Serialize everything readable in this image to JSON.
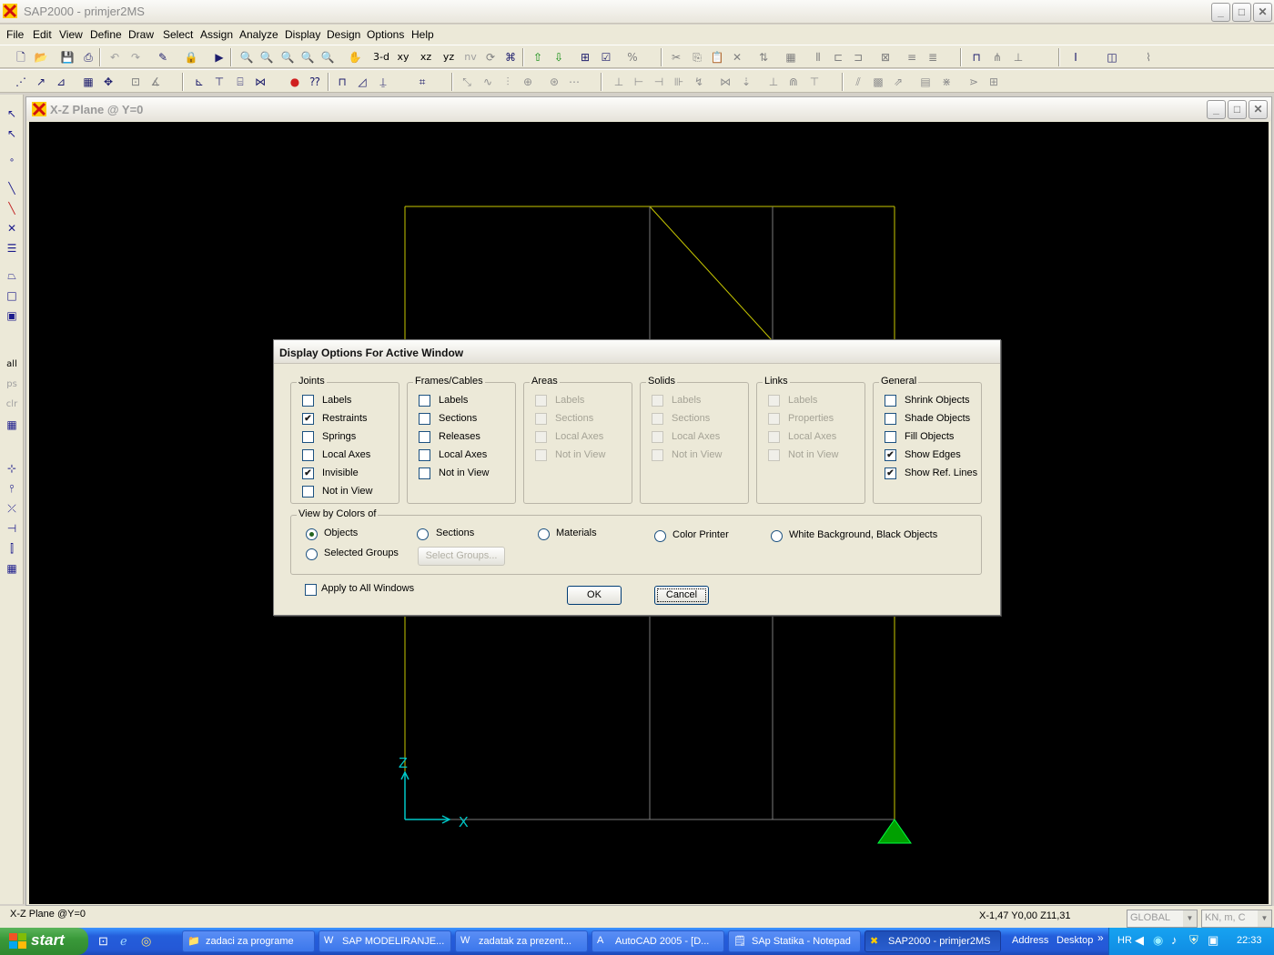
{
  "app": {
    "title": "SAP2000 - primjer2MS",
    "window_buttons": {
      "minimize": "_",
      "maximize": "□",
      "close": "✕"
    }
  },
  "menu": [
    "File",
    "Edit",
    "View",
    "Define",
    "Draw",
    "Select",
    "Assign",
    "Analyze",
    "Display",
    "Design",
    "Options",
    "Help"
  ],
  "toolbar1": {
    "view_buttons": [
      "3-d",
      "xy",
      "xz",
      "yz",
      "nv"
    ]
  },
  "child_window": {
    "title": "X-Z Plane @ Y=0",
    "canvas_bg": "#000000",
    "frame_color": "#c8c800",
    "axis_color": "#00c8c8",
    "restraint_color": "#00a000",
    "axes": {
      "x_label": "X",
      "z_label": "Z"
    }
  },
  "dialog": {
    "title": "Display Options For Active Window",
    "groups": [
      {
        "label": "Joints",
        "items": [
          {
            "label": "Labels",
            "checked": false,
            "enabled": true
          },
          {
            "label": "Restraints",
            "checked": true,
            "enabled": true
          },
          {
            "label": "Springs",
            "checked": false,
            "enabled": true
          },
          {
            "label": "Local Axes",
            "checked": false,
            "enabled": true
          },
          {
            "label": "Invisible",
            "checked": true,
            "enabled": true
          },
          {
            "label": "Not in View",
            "checked": false,
            "enabled": true
          }
        ]
      },
      {
        "label": "Frames/Cables",
        "items": [
          {
            "label": "Labels",
            "checked": false,
            "enabled": true
          },
          {
            "label": "Sections",
            "checked": false,
            "enabled": true
          },
          {
            "label": "Releases",
            "checked": false,
            "enabled": true
          },
          {
            "label": "Local Axes",
            "checked": false,
            "enabled": true
          },
          {
            "label": "Not in View",
            "checked": false,
            "enabled": true
          }
        ]
      },
      {
        "label": "Areas",
        "items": [
          {
            "label": "Labels",
            "checked": false,
            "enabled": false
          },
          {
            "label": "Sections",
            "checked": false,
            "enabled": false
          },
          {
            "label": "Local Axes",
            "checked": false,
            "enabled": false
          },
          {
            "label": "Not in View",
            "checked": false,
            "enabled": false
          }
        ]
      },
      {
        "label": "Solids",
        "items": [
          {
            "label": "Labels",
            "checked": false,
            "enabled": false
          },
          {
            "label": "Sections",
            "checked": false,
            "enabled": false
          },
          {
            "label": "Local Axes",
            "checked": false,
            "enabled": false
          },
          {
            "label": "Not in View",
            "checked": false,
            "enabled": false
          }
        ]
      },
      {
        "label": "Links",
        "items": [
          {
            "label": "Labels",
            "checked": false,
            "enabled": false
          },
          {
            "label": "Properties",
            "checked": false,
            "enabled": false
          },
          {
            "label": "Local Axes",
            "checked": false,
            "enabled": false
          },
          {
            "label": "Not in View",
            "checked": false,
            "enabled": false
          }
        ]
      },
      {
        "label": "General",
        "items": [
          {
            "label": "Shrink Objects",
            "checked": false,
            "enabled": true
          },
          {
            "label": "Shade Objects",
            "checked": false,
            "enabled": true
          },
          {
            "label": "Fill Objects",
            "checked": false,
            "enabled": true
          },
          {
            "label": "Show Edges",
            "checked": true,
            "enabled": true
          },
          {
            "label": "Show Ref. Lines",
            "checked": true,
            "enabled": true
          }
        ]
      }
    ],
    "view_by_colors": {
      "label": "View by Colors of",
      "options": [
        {
          "label": "Objects",
          "selected": true
        },
        {
          "label": "Sections",
          "selected": false
        },
        {
          "label": "Materials",
          "selected": false
        },
        {
          "label": "Color Printer",
          "selected": false
        },
        {
          "label": "White Background, Black Objects",
          "selected": false
        },
        {
          "label": "Selected Groups",
          "selected": false
        }
      ],
      "select_groups_button": "Select Groups..."
    },
    "apply_all": {
      "label": "Apply to All Windows",
      "checked": false
    },
    "ok_label": "OK",
    "cancel_label": "Cancel"
  },
  "status": {
    "left_text": "X-Z Plane @Y=0",
    "coords": "X-1,47  Y0,00  Z11,31",
    "coord_system": "GLOBAL",
    "units": "KN, m, C"
  },
  "taskbar": {
    "start_label": "start",
    "tasks": [
      {
        "label": "zadaci za programe",
        "active": false
      },
      {
        "label": "SAP  MODELIRANJE...",
        "active": false
      },
      {
        "label": "zadatak za prezent...",
        "active": false
      },
      {
        "label": "AutoCAD 2005 - [D...",
        "active": false
      },
      {
        "label": "SAp Statika - Notepad",
        "active": false
      },
      {
        "label": "SAP2000 - primjer2MS",
        "active": true
      }
    ],
    "address_label": "Address",
    "desktop_label": "Desktop",
    "lang": "HR",
    "clock": "22:33"
  }
}
